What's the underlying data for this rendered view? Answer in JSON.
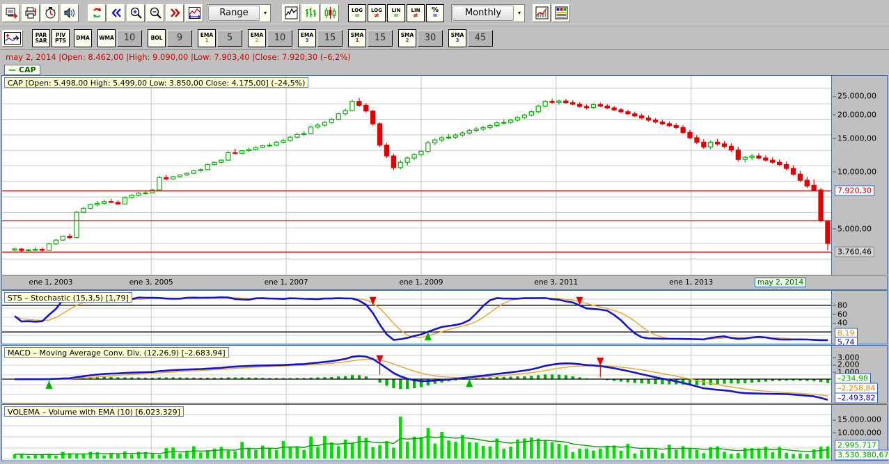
{
  "toolbar_top": {
    "groups": [
      {
        "buttons": [
          {
            "name": "save-workspace-button",
            "icon": "save-icon"
          },
          {
            "name": "print-button",
            "icon": "printer-icon"
          },
          {
            "name": "timer-button",
            "icon": "clock-icon"
          },
          {
            "name": "sound-alerts-button",
            "icon": "speaker-icon"
          }
        ]
      },
      {
        "buttons": [
          {
            "name": "refresh-button",
            "icon": "refresh-icon"
          },
          {
            "name": "scroll-back-button",
            "icon": "double-chevron-left-icon"
          },
          {
            "name": "zoom-in-button",
            "icon": "magnifier-plus-icon"
          },
          {
            "name": "zoom-out-button",
            "icon": "magnifier-minus-icon"
          },
          {
            "name": "scroll-forward-button",
            "icon": "double-chevron-right-icon"
          },
          {
            "name": "fit-range-button",
            "icon": "fit-width-icon"
          }
        ]
      }
    ],
    "range_dropdown": {
      "label": "Range",
      "arrow": "▾"
    },
    "chart_type_buttons": [
      {
        "name": "line-chart-button",
        "icon": "line-chart-icon"
      },
      {
        "name": "bar-chart-button",
        "icon": "ohlc-bar-icon"
      },
      {
        "name": "candlestick-chart-button",
        "icon": "candlestick-icon"
      }
    ],
    "scale_buttons": [
      {
        "name": "log-scale-equal-button",
        "top": "LOG",
        "op": "=",
        "color": "#008000"
      },
      {
        "name": "log-scale-notequal-button",
        "top": "LOG",
        "op": "≠",
        "color": "#cc0000"
      },
      {
        "name": "lin-scale-equal-button",
        "top": "LIN",
        "op": "=",
        "color": "#008000"
      },
      {
        "name": "lin-scale-notequal-button",
        "top": "LIN",
        "op": "≠",
        "color": "#cc0000"
      },
      {
        "name": "percent-scale-button",
        "top": "%",
        "op": "=",
        "color": "#0000cc"
      }
    ],
    "timeframe_dropdown": {
      "label": "Monthly",
      "arrow": "▾"
    },
    "right_buttons": [
      {
        "name": "indicator-chart-button",
        "icon": "indicator-chart-icon"
      },
      {
        "name": "color-settings-button",
        "icon": "color-palette-icon"
      }
    ]
  },
  "toolbar_indicators": {
    "add_indicator_button": {
      "name": "add-indicator-button",
      "icon": "add-indicator-icon"
    },
    "items": [
      {
        "name": "par-sar-button",
        "line1": "PAR",
        "line2": "SAR",
        "color": "#000000",
        "value": null
      },
      {
        "name": "piv-pts-button",
        "line1": "PIV",
        "line2": "PTS",
        "color": "#000000",
        "value": null
      },
      {
        "name": "dma-button",
        "line1": "DMA",
        "line2": "",
        "color": "#000000",
        "value": null
      },
      {
        "name": "wma-button",
        "line1": "WMA",
        "line2": "",
        "color": "#000000",
        "value": "10"
      },
      {
        "name": "bol-button",
        "line1": "BOL",
        "line2": "",
        "color": "#000000",
        "value": "9"
      },
      {
        "name": "ema1-button",
        "line1": "EMA",
        "line2": "1",
        "color": "#cc6600",
        "value": "5"
      },
      {
        "name": "ema2-button",
        "line1": "EMA",
        "line2": "2",
        "color": "#e0a000",
        "value": "10"
      },
      {
        "name": "ema3-button",
        "line1": "EMA",
        "line2": "3",
        "color": "#3040d0",
        "value": "15"
      },
      {
        "name": "sma1-button",
        "line1": "SMA",
        "line2": "1",
        "color": "#cc0000",
        "value": "15"
      },
      {
        "name": "sma2-button",
        "line1": "SMA",
        "line2": "2",
        "color": "#a020a0",
        "value": "30"
      },
      {
        "name": "sma3-button",
        "line1": "SMA",
        "line2": "3",
        "color": "#2040d0",
        "value": "45"
      }
    ]
  },
  "quote_line": "may 2, 2014 |Open: 8.462,00 |High: 9.090,00 |Low: 7.903,40 |Close: 7.920,30 (–6,2%)",
  "legend": {
    "dash": "—",
    "symbol": "CAP"
  },
  "price_pane": {
    "title": "CAP [Open: 5.498,00  High: 5.499,00  Low: 3.850,00  Close: 4.175,00] (–24,5%)",
    "axis_ticks": [
      "25.000,00",
      "20.000,00",
      "15.000,00",
      "10.000,00",
      "5.000,00"
    ],
    "price_tag": "7.920,30",
    "low_tag": "3.760,46"
  },
  "time_axis": {
    "ticks": [
      "ene 1, 2003",
      "ene 3, 2005",
      "ene 1, 2007",
      "ene 1, 2009",
      "ene 3, 2011",
      "ene 1, 2013"
    ],
    "current_tag": "may 2, 2014"
  },
  "sts_pane": {
    "title": "STS – Stochastic (15,3,5) [1,79]",
    "axis_ticks": [
      "80",
      "60",
      "40"
    ],
    "tag_d": "8,19",
    "tag_k": "5,74",
    "close_icon": "✕"
  },
  "macd_pane": {
    "title": "MACD – Moving Average Conv. Div. (12,26,9) [–2.683,94]",
    "axis_ticks": [
      "3.000",
      "2.000",
      "1.000"
    ],
    "tag_hist": "–234,98",
    "tag_signal": "–2.258,84",
    "tag_macd": "–2.493,82",
    "close_icon": "✕"
  },
  "volume_pane": {
    "title": "VOLEMA – Volume with EMA (10) [6.023.329]",
    "axis_ticks": [
      "15.000.000",
      "10.000.000"
    ],
    "tag_volume": "2.995.717",
    "tag_ema": "3.530.380,67",
    "close_icon": "✕"
  },
  "colors": {
    "up_candle": "#00b000",
    "down_candle": "#e00000",
    "support_line": "#e00000",
    "macd_line": "#1414c8",
    "signal_line": "#e8a838",
    "histogram": "#00b000",
    "volume_bar": "#00dd00",
    "buy_marker": "#00b000",
    "sell_marker": "#e00000",
    "pane_border": "#4a6fa5",
    "toolbar_bg": "#c0c0c0"
  },
  "chart_data": {
    "type": "candlestick",
    "title": "CAP",
    "timeframe": "Monthly",
    "scale": "log",
    "ylabel": "",
    "xlabel": "",
    "ylim": [
      3000,
      28000
    ],
    "support_levels": [
      7920.3,
      5498,
      3760.46
    ],
    "x_tick_labels": [
      "ene 1, 2003",
      "ene 3, 2005",
      "ene 1, 2007",
      "ene 1, 2009",
      "ene 3, 2011",
      "ene 1, 2013"
    ],
    "y_tick_values": [
      25000,
      20000,
      15000,
      10000,
      5000
    ],
    "ohlc": [
      [
        3850,
        3980,
        3800,
        3900
      ],
      [
        3900,
        3960,
        3760,
        3830
      ],
      [
        3830,
        3900,
        3780,
        3860
      ],
      [
        3860,
        3990,
        3830,
        3880
      ],
      [
        3880,
        3960,
        3790,
        3840
      ],
      [
        3840,
        4200,
        3820,
        4150
      ],
      [
        4150,
        4400,
        4100,
        4350
      ],
      [
        4350,
        4600,
        4300,
        4560
      ],
      [
        4560,
        4700,
        4400,
        4480
      ],
      [
        4480,
        6200,
        4450,
        6100
      ],
      [
        6100,
        6500,
        6050,
        6400
      ],
      [
        6400,
        6800,
        6300,
        6700
      ],
      [
        6700,
        7000,
        6550,
        6800
      ],
      [
        6800,
        7100,
        6700,
        6950
      ],
      [
        6950,
        7200,
        6800,
        6880
      ],
      [
        6880,
        7050,
        6700,
        6750
      ],
      [
        6750,
        7400,
        6700,
        7300
      ],
      [
        7300,
        7600,
        7200,
        7500
      ],
      [
        7500,
        7800,
        7400,
        7700
      ],
      [
        7700,
        7900,
        7550,
        7720
      ],
      [
        7720,
        8100,
        7700,
        8000
      ],
      [
        8000,
        9500,
        7950,
        9300
      ],
      [
        9300,
        9600,
        9000,
        9150
      ],
      [
        9150,
        9500,
        9050,
        9400
      ],
      [
        9400,
        9700,
        9300,
        9600
      ],
      [
        9600,
        9900,
        9450,
        9800
      ],
      [
        9800,
        10200,
        9700,
        10100
      ],
      [
        10100,
        10400,
        9950,
        10250
      ],
      [
        10250,
        11000,
        10200,
        10900
      ],
      [
        10900,
        11300,
        10800,
        11200
      ],
      [
        11200,
        11600,
        11050,
        11500
      ],
      [
        11500,
        12800,
        11400,
        12600
      ],
      [
        12600,
        13200,
        12300,
        12500
      ],
      [
        12500,
        13000,
        12400,
        12900
      ],
      [
        12900,
        13400,
        12700,
        13100
      ],
      [
        13100,
        13600,
        12950,
        13450
      ],
      [
        13450,
        13900,
        13300,
        13700
      ],
      [
        13700,
        14200,
        13500,
        13800
      ],
      [
        13800,
        14500,
        13650,
        14300
      ],
      [
        14300,
        14900,
        14100,
        14600
      ],
      [
        14600,
        15400,
        14400,
        15200
      ],
      [
        15200,
        16000,
        15000,
        15700
      ],
      [
        15700,
        16400,
        15400,
        15900
      ],
      [
        15900,
        17500,
        15800,
        17200
      ],
      [
        17200,
        18000,
        16900,
        17600
      ],
      [
        17600,
        18500,
        17300,
        18200
      ],
      [
        18200,
        19200,
        17900,
        18900
      ],
      [
        18900,
        20500,
        18700,
        20200
      ],
      [
        20200,
        21500,
        19800,
        21000
      ],
      [
        21000,
        24000,
        20800,
        23500
      ],
      [
        23500,
        24500,
        22000,
        22400
      ],
      [
        22400,
        23000,
        20500,
        20900
      ],
      [
        20900,
        21200,
        17500,
        17900
      ],
      [
        17900,
        18200,
        13500,
        13800
      ],
      [
        13800,
        14200,
        11800,
        12100
      ],
      [
        12100,
        12400,
        10200,
        10500
      ],
      [
        10500,
        11500,
        10300,
        11200
      ],
      [
        11200,
        12000,
        10800,
        11800
      ],
      [
        11800,
        12500,
        11500,
        12300
      ],
      [
        12300,
        13000,
        12000,
        12800
      ],
      [
        12800,
        14500,
        12600,
        14200
      ],
      [
        14200,
        15000,
        13800,
        14700
      ],
      [
        14700,
        15400,
        14300,
        15100
      ],
      [
        15100,
        15800,
        14800,
        15200
      ],
      [
        15200,
        15900,
        14900,
        15600
      ],
      [
        15600,
        16300,
        15300,
        16000
      ],
      [
        16000,
        16800,
        15700,
        16500
      ],
      [
        16500,
        17200,
        16200,
        16800
      ],
      [
        16800,
        17400,
        16400,
        17100
      ],
      [
        17100,
        17800,
        16800,
        17500
      ],
      [
        17500,
        18400,
        17200,
        18100
      ],
      [
        18100,
        18800,
        17700,
        18200
      ],
      [
        18200,
        19000,
        17900,
        18700
      ],
      [
        18700,
        19600,
        18400,
        19300
      ],
      [
        19300,
        20200,
        19000,
        19900
      ],
      [
        19900,
        21000,
        19600,
        20700
      ],
      [
        20700,
        22500,
        20400,
        22200
      ],
      [
        22200,
        23800,
        21900,
        23500
      ],
      [
        23500,
        24300,
        22800,
        23200
      ],
      [
        23200,
        24000,
        22600,
        23600
      ],
      [
        23600,
        24200,
        22900,
        23100
      ],
      [
        23100,
        23800,
        22400,
        22700
      ],
      [
        22700,
        23200,
        21800,
        22100
      ],
      [
        22100,
        22600,
        21300,
        21800
      ],
      [
        21800,
        22900,
        21500,
        22600
      ],
      [
        22600,
        23100,
        21900,
        22200
      ],
      [
        22200,
        22700,
        21400,
        21700
      ],
      [
        21700,
        22200,
        20900,
        21200
      ],
      [
        21200,
        21700,
        20400,
        20700
      ],
      [
        20700,
        21200,
        19900,
        20200
      ],
      [
        20200,
        20700,
        19400,
        19700
      ],
      [
        19700,
        20200,
        18900,
        19200
      ],
      [
        19200,
        19800,
        18400,
        18700
      ],
      [
        18700,
        19200,
        18000,
        18300
      ],
      [
        18300,
        18800,
        17600,
        17900
      ],
      [
        17900,
        18400,
        17200,
        17500
      ],
      [
        17500,
        18000,
        16800,
        17100
      ],
      [
        17100,
        17600,
        15800,
        16100
      ],
      [
        16100,
        16600,
        14800,
        15100
      ],
      [
        15100,
        15600,
        14000,
        14300
      ],
      [
        14300,
        14800,
        13200,
        13500
      ],
      [
        13500,
        14600,
        13100,
        14300
      ],
      [
        14300,
        14900,
        13700,
        14000
      ],
      [
        14000,
        14500,
        13300,
        13600
      ],
      [
        13600,
        14100,
        12700,
        13000
      ],
      [
        13000,
        13500,
        11300,
        11600
      ],
      [
        11600,
        12100,
        11200,
        11900
      ],
      [
        11900,
        12400,
        11500,
        12100
      ],
      [
        12100,
        12500,
        11600,
        11800
      ],
      [
        11800,
        12200,
        11300,
        11500
      ],
      [
        11500,
        11900,
        11000,
        11200
      ],
      [
        11200,
        11600,
        10700,
        10900
      ],
      [
        10900,
        11300,
        10200,
        10400
      ],
      [
        10400,
        10800,
        9500,
        9700
      ],
      [
        9700,
        10100,
        8800,
        9000
      ],
      [
        9000,
        9400,
        8200,
        8400
      ],
      [
        8462,
        9090,
        7903,
        7920
      ],
      [
        8000,
        8200,
        5400,
        5500
      ],
      [
        5498,
        5499,
        3850,
        4175
      ]
    ],
    "volume": {
      "type": "bar",
      "y_tick_values": [
        15000000,
        10000000
      ],
      "ema_period": 10,
      "last_value": 6023329,
      "tag_volume": 2995717,
      "tag_ema": 3530380.67
    },
    "stochastic": {
      "type": "line",
      "params": [
        15,
        3,
        5
      ],
      "last_value": 1.79,
      "k_last": 5.74,
      "d_last": 8.19,
      "levels": [
        80,
        20
      ],
      "y_tick_values": [
        80,
        60,
        40
      ]
    },
    "macd": {
      "type": "line",
      "params": [
        12,
        26,
        9
      ],
      "last_value": -2683.94,
      "macd_last": -2493.82,
      "signal_last": -2258.84,
      "histogram_last": -234.98,
      "y_tick_values": [
        3000,
        2000,
        1000
      ]
    }
  }
}
